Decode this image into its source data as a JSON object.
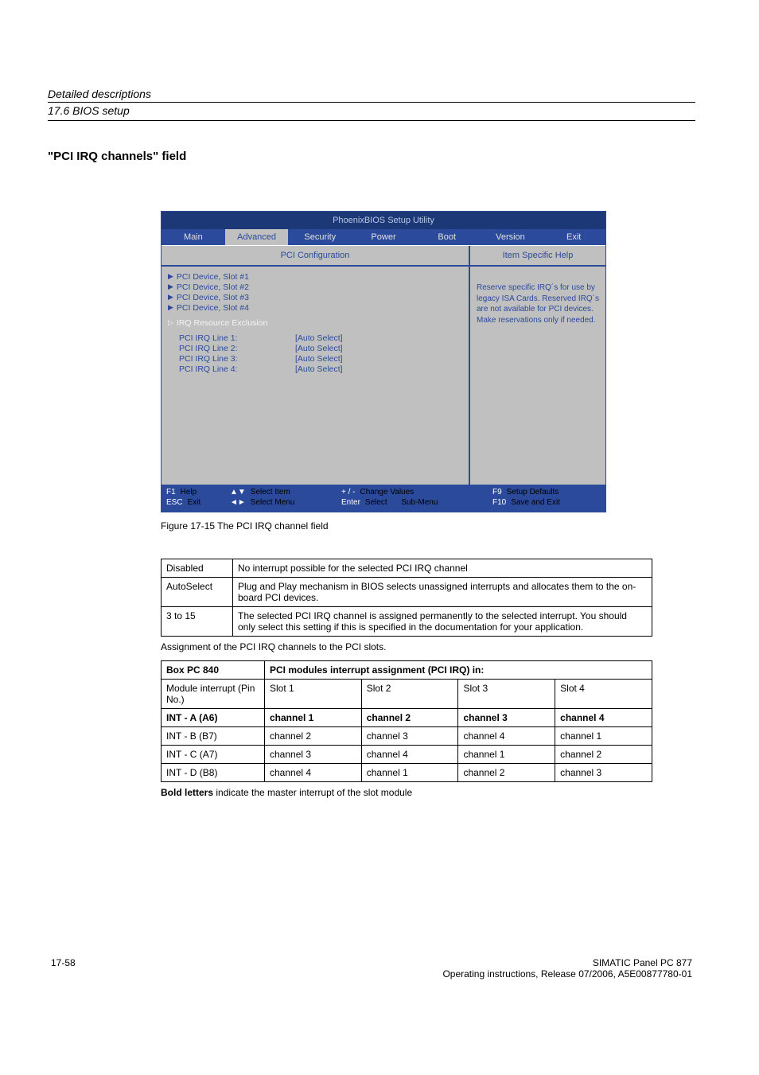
{
  "header": {
    "line1": "Detailed descriptions",
    "line2": "17.6 BIOS setup"
  },
  "section_title": "\"PCI IRQ channels\" field",
  "bios": {
    "title": "PhoenixBIOS Setup Utility",
    "tabs": [
      "Main",
      "Advanced",
      "Security",
      "Power",
      "Boot",
      "Version",
      "Exit"
    ],
    "left_title": "PCI Configuration",
    "right_title": "Item Specific Help",
    "right_text": "Reserve specific IRQ´s for use by legacy ISA Cards. Reserved IRQ´s are not available for PCI devices. Make reservations only if needed.",
    "items1": [
      "PCI Device, Slot #1",
      "PCI Device, Slot #2",
      "PCI Device, Slot #3",
      "PCI Device, Slot #4"
    ],
    "irq_excl": "IRQ Resource Exclusion",
    "lines": [
      {
        "k": "PCI IRQ Line 1:",
        "v": "[Auto Select]"
      },
      {
        "k": "PCI IRQ Line 2:",
        "v": "[Auto Select]"
      },
      {
        "k": "PCI IRQ Line 3:",
        "v": "[Auto Select]"
      },
      {
        "k": "PCI IRQ Line 4:",
        "v": "[Auto Select]"
      }
    ],
    "footer": {
      "c1a_k": "F1",
      "c1a_l": "Help",
      "c1b_k": "ESC",
      "c1b_l": "Exit",
      "c2a_sym": "▲▼",
      "c2a_l": "Select Item",
      "c2b_sym": "◄►",
      "c2b_l": "Select Menu",
      "c3a_k": "+ / -",
      "c3a_l": "Change Values",
      "c3b_k": "Enter",
      "c3b_l": "Select",
      "c3b_l2": "Sub-Menu",
      "c4a_k": "F9",
      "c4a_l": "Setup Defaults",
      "c4b_k": "F10",
      "c4b_l": "Save and Exit"
    }
  },
  "figure_caption": "Figure 17-15   The PCI IRQ channel field",
  "table1": {
    "rows": [
      [
        "Disabled",
        "No interrupt possible for the selected PCI IRQ channel"
      ],
      [
        "AutoSelect",
        "Plug and Play mechanism in BIOS selects unassigned interrupts and allocates them to the on-board PCI devices."
      ],
      [
        "3 to 15",
        "The selected PCI IRQ channel is assigned permanently to the selected interrupt. You should only select this setting if this is specified in the documentation for your application."
      ]
    ]
  },
  "between_text": "Assignment of the PCI IRQ channels to the PCI slots.",
  "table2": {
    "hdr_left": "Box PC 840",
    "hdr_right": "PCI modules interrupt assignment (PCI IRQ) in:",
    "sub": [
      "Module interrupt (Pin No.)",
      "Slot 1",
      "Slot 2",
      "Slot 3",
      "Slot 4"
    ],
    "rows": [
      {
        "label": "INT - A (A6)",
        "bold": true,
        "cells": [
          "channel 1",
          "channel 2",
          "channel 3",
          "channel 4"
        ]
      },
      {
        "label": "INT - B (B7)",
        "bold": false,
        "cells": [
          "channel 2",
          "channel 3",
          "channel 4",
          "channel 1"
        ]
      },
      {
        "label": "INT - C (A7)",
        "bold": false,
        "cells": [
          "channel 3",
          "channel 4",
          "channel 1",
          "channel 2"
        ]
      },
      {
        "label": "INT - D (B8)",
        "bold": false,
        "cells": [
          "channel 4",
          "channel 1",
          "channel 2",
          "channel 3"
        ]
      }
    ]
  },
  "post_note": {
    "bold": "Bold letters",
    "rest": " indicate the master interrupt of the slot module"
  },
  "footer": {
    "left": "17-58",
    "r1": "SIMATIC Panel PC 877",
    "r2": "Operating instructions, Release 07/2006, A5E00877780-01"
  }
}
